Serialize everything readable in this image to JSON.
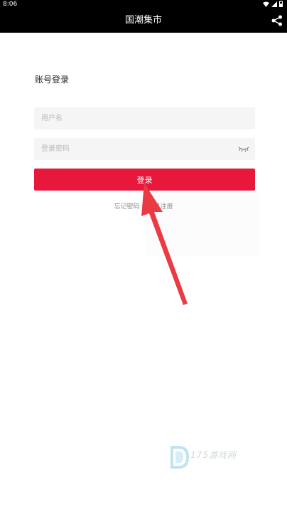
{
  "status_bar": {
    "time": "8:06"
  },
  "header": {
    "title": "国潮集市"
  },
  "login": {
    "section_title": "账号登录",
    "username_placeholder": "用户名",
    "password_placeholder": "登录密码",
    "login_button": "登录",
    "forgot_password": "忘记密码",
    "register": "账号注册"
  },
  "watermark": {
    "text": "175游戏网"
  },
  "colors": {
    "accent": "#e8173c",
    "header_bg": "#000000",
    "field_bg": "#f5f5f5"
  },
  "icons": [
    "wifi-icon",
    "signal-icon",
    "battery-icon",
    "share-icon",
    "eye-closed-icon"
  ]
}
